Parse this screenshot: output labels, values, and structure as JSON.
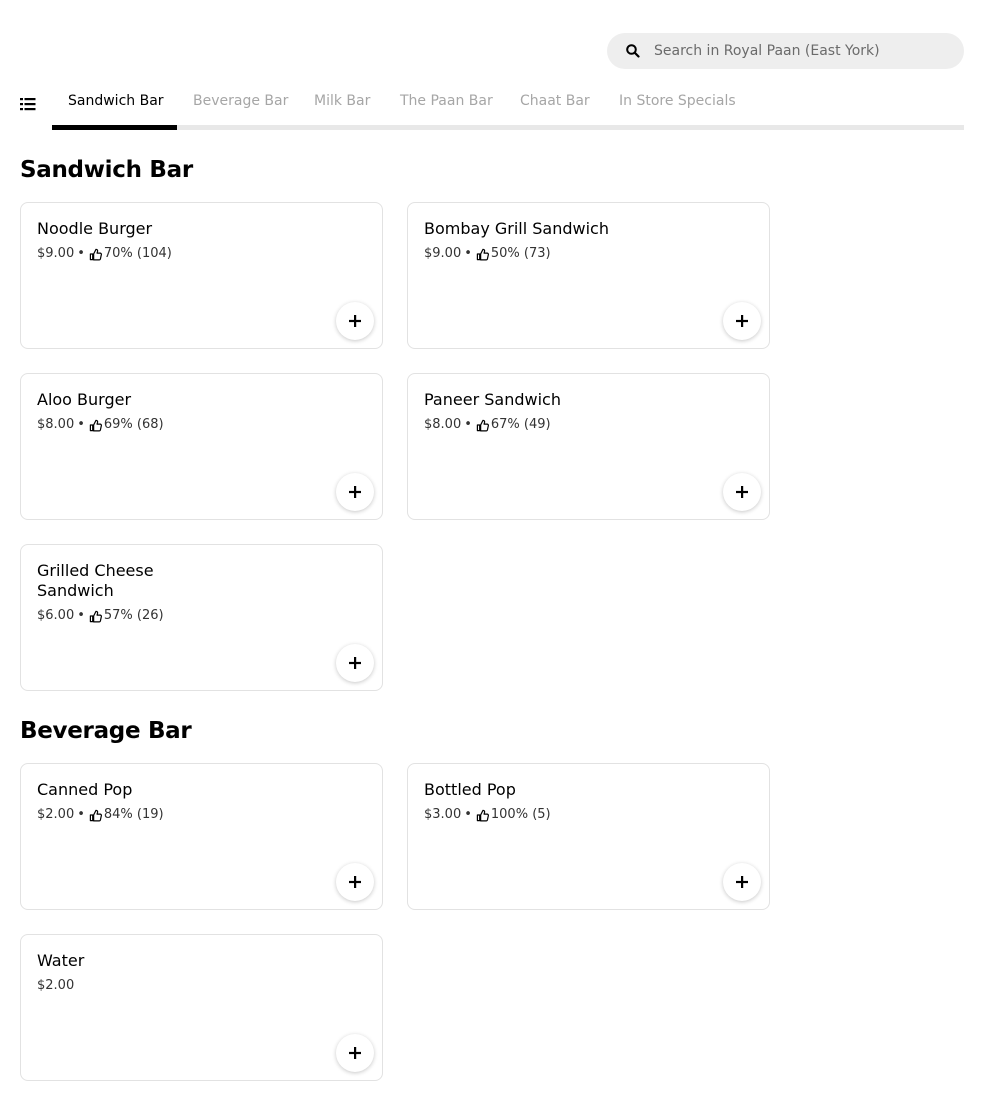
{
  "search": {
    "placeholder": "Search in Royal Paan (East York)"
  },
  "tabs": [
    {
      "label": "Sandwich Bar",
      "active": true
    },
    {
      "label": "Beverage Bar",
      "active": false
    },
    {
      "label": "Milk Bar",
      "active": false
    },
    {
      "label": "The Paan Bar",
      "active": false
    },
    {
      "label": "Chaat Bar",
      "active": false
    },
    {
      "label": "In Store Specials",
      "active": false
    }
  ],
  "sections": [
    {
      "title": "Sandwich Bar",
      "items": [
        {
          "name": "Noodle Burger",
          "price": "$9.00",
          "rating": "70% (104)"
        },
        {
          "name": "Bombay Grill Sandwich",
          "price": "$9.00",
          "rating": "50% (73)"
        },
        {
          "name": "Aloo Burger",
          "price": "$8.00",
          "rating": "69% (68)"
        },
        {
          "name": "Paneer Sandwich",
          "price": "$8.00",
          "rating": "67% (49)"
        },
        {
          "name": "Grilled Cheese Sandwich",
          "price": "$6.00",
          "rating": "57% (26)"
        }
      ]
    },
    {
      "title": "Beverage Bar",
      "items": [
        {
          "name": "Canned Pop",
          "price": "$2.00",
          "rating": "84% (19)"
        },
        {
          "name": "Bottled Pop",
          "price": "$3.00",
          "rating": "100% (5)"
        },
        {
          "name": "Water",
          "price": "$2.00"
        }
      ]
    }
  ],
  "icons": {
    "search": "search-icon",
    "menu": "list-menu-icon",
    "rating": "thumbs-up-icon",
    "add": "plus-icon"
  },
  "colors": {
    "accent": "#000000",
    "muted_tab": "#a6a6a6",
    "search_bg": "#eeeeee",
    "card_border": "#e2e2e2"
  }
}
